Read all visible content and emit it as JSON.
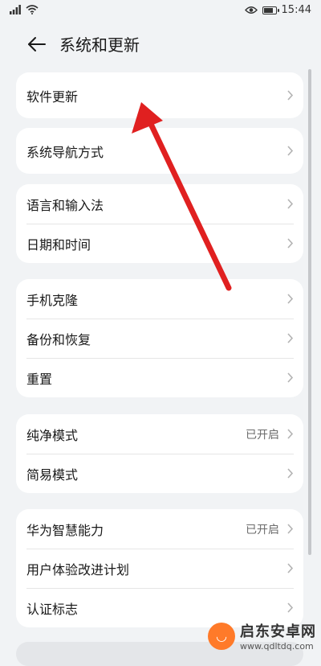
{
  "status_bar": {
    "time": "15:44",
    "icons": [
      "signal-icon",
      "wifi-icon",
      "eye-icon",
      "battery-icon"
    ],
    "battery_level": 0.85
  },
  "header": {
    "title": "系统和更新",
    "back_icon": "back-arrow-icon"
  },
  "groups": [
    {
      "items": [
        {
          "label": "软件更新"
        }
      ]
    },
    {
      "items": [
        {
          "label": "系统导航方式"
        }
      ]
    },
    {
      "items": [
        {
          "label": "语言和输入法"
        },
        {
          "label": "日期和时间"
        }
      ]
    },
    {
      "items": [
        {
          "label": "手机克隆"
        },
        {
          "label": "备份和恢复"
        },
        {
          "label": "重置"
        }
      ]
    },
    {
      "items": [
        {
          "label": "纯净模式",
          "value": "已开启"
        },
        {
          "label": "简易模式"
        }
      ]
    },
    {
      "items": [
        {
          "label": "华为智慧能力",
          "value": "已开启"
        },
        {
          "label": "用户体验改进计划"
        },
        {
          "label": "认证标志"
        }
      ]
    }
  ],
  "watermark": {
    "title": "启东安卓网",
    "url": "www.qdltdq.com"
  },
  "colors": {
    "arrow": "#e02020",
    "background": "#f1f3f5",
    "card": "#ffffff"
  }
}
